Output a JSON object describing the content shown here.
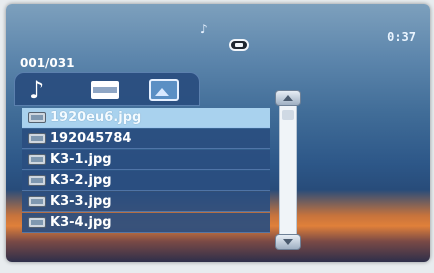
{
  "status": {
    "clock": "0:37",
    "music_icon": "music-note-icon",
    "battery_icon": "battery-icon"
  },
  "browser": {
    "counter": "001/031",
    "tabs": [
      {
        "name": "music",
        "icon": "music-note-icon"
      },
      {
        "name": "video",
        "icon": "film-icon"
      },
      {
        "name": "photo",
        "icon": "photo-icon"
      }
    ],
    "files": [
      {
        "name": "1920eu6.jpg",
        "selected": true
      },
      {
        "name": "192045784",
        "selected": false
      },
      {
        "name": "K3-1.jpg",
        "selected": false
      },
      {
        "name": "K3-2.jpg",
        "selected": false
      },
      {
        "name": "K3-3.jpg",
        "selected": false
      },
      {
        "name": "K3-4.jpg",
        "selected": false
      }
    ]
  }
}
